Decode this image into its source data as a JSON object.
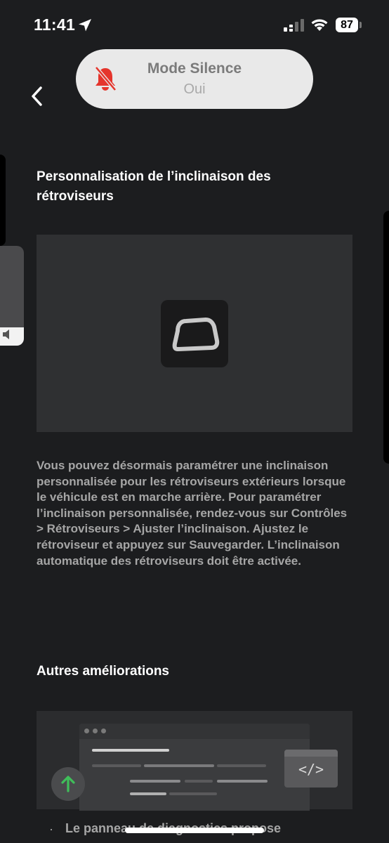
{
  "status_bar": {
    "time": "11:41",
    "battery": "87"
  },
  "silent_mode": {
    "title": "Mode Silence",
    "value": "Oui",
    "icon": "bell-slash-icon",
    "icon_color": "#e5352c"
  },
  "article": {
    "section1_title": "Personnalisation de l’inclinaison des rétroviseurs",
    "media_icon": "mirror-icon",
    "paragraph": "Vous pouvez désormais paramétrer une inclinaison personnalisée pour les rétroviseurs extérieurs lorsque le véhicule est en marche arrière. Pour paramétrer l’inclinaison personnalisée, rendez-vous sur Contrôles > Rétroviseurs > Ajuster l’inclinaison. Ajustez le rétroviseur et appuyez sur Sauvegarder. L’inclinaison automatique des rétroviseurs doit être activée.",
    "section2_title": "Autres améliorations",
    "code_glyph": "</>",
    "bullet_marker": "·",
    "bullet_text": "Le panneau de diagnostics propose"
  },
  "colors": {
    "background": "#1c1d1f",
    "media_bg": "#2f3032",
    "upgrade_arrow": "#3fbf5a"
  }
}
